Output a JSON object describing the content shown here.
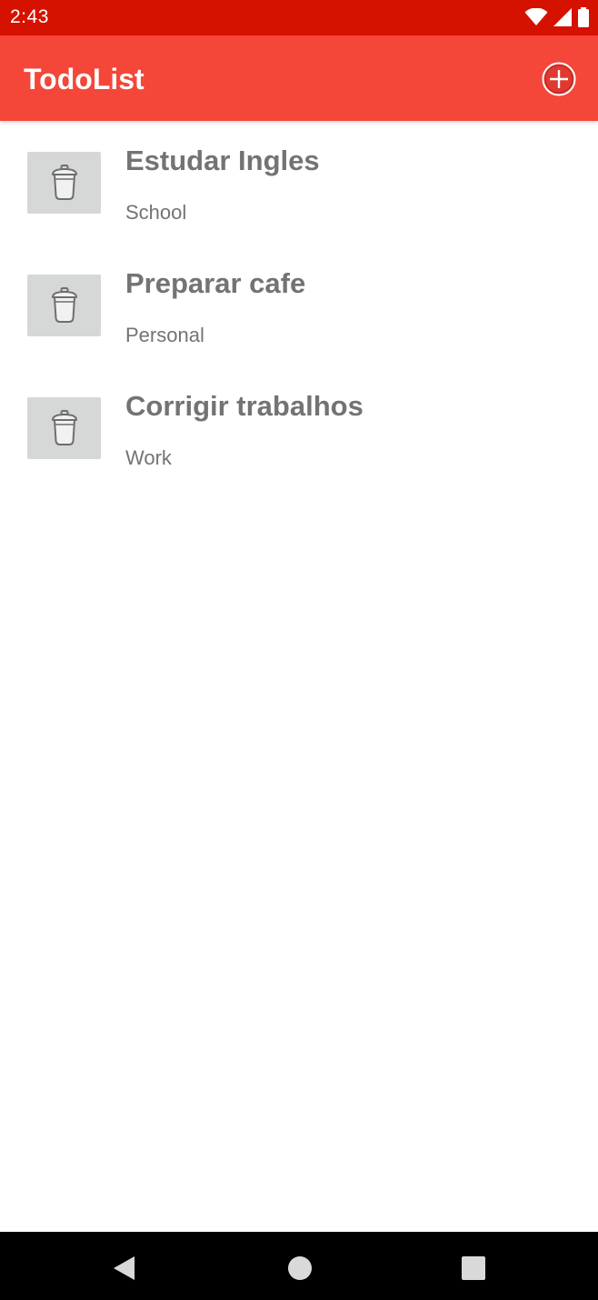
{
  "status_bar": {
    "time": "2:43",
    "icons": [
      "wifi-icon",
      "cell-signal-icon",
      "battery-icon"
    ]
  },
  "app_bar": {
    "title": "TodoList",
    "add_icon": "add-circle-icon",
    "color": "#f5463a"
  },
  "todos": [
    {
      "title": "Estudar Ingles",
      "category": "School"
    },
    {
      "title": "Preparar cafe",
      "category": "Personal"
    },
    {
      "title": "Corrigir trabalhos",
      "category": "Work"
    }
  ],
  "nav_bar": {
    "buttons": [
      "back-icon",
      "home-icon",
      "recents-icon"
    ]
  },
  "colors": {
    "status_bar": "#d51200",
    "app_bar": "#f5463a",
    "text": "#737373",
    "delete_button_bg": "#d6d7d7"
  }
}
